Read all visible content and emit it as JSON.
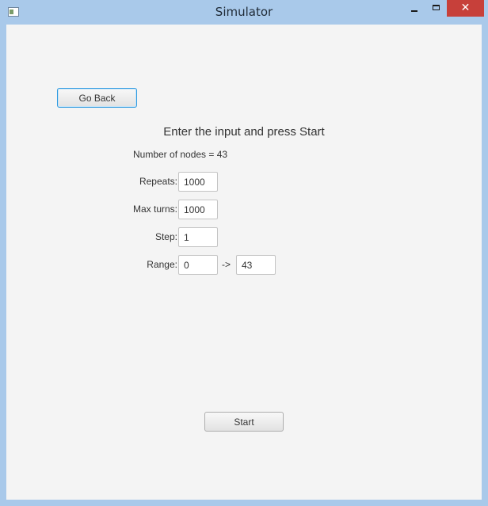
{
  "window": {
    "title": "Simulator",
    "close_glyph": "✕",
    "accent_color": "#2f9ae0",
    "close_color": "#c7403a"
  },
  "main": {
    "back_label": "Go Back",
    "instruction": "Enter the input and press Start",
    "nodes_text": "Number of nodes = 43",
    "repeats_label": "Repeats:",
    "repeats_value": "1000",
    "max_turns_label": "Max turns:",
    "max_turns_value": "1000",
    "step_label": "Step:",
    "step_value": "1",
    "range_label": "Range:",
    "range_from": "0",
    "range_arrow": "->",
    "range_to": "43",
    "start_label": "Start"
  }
}
